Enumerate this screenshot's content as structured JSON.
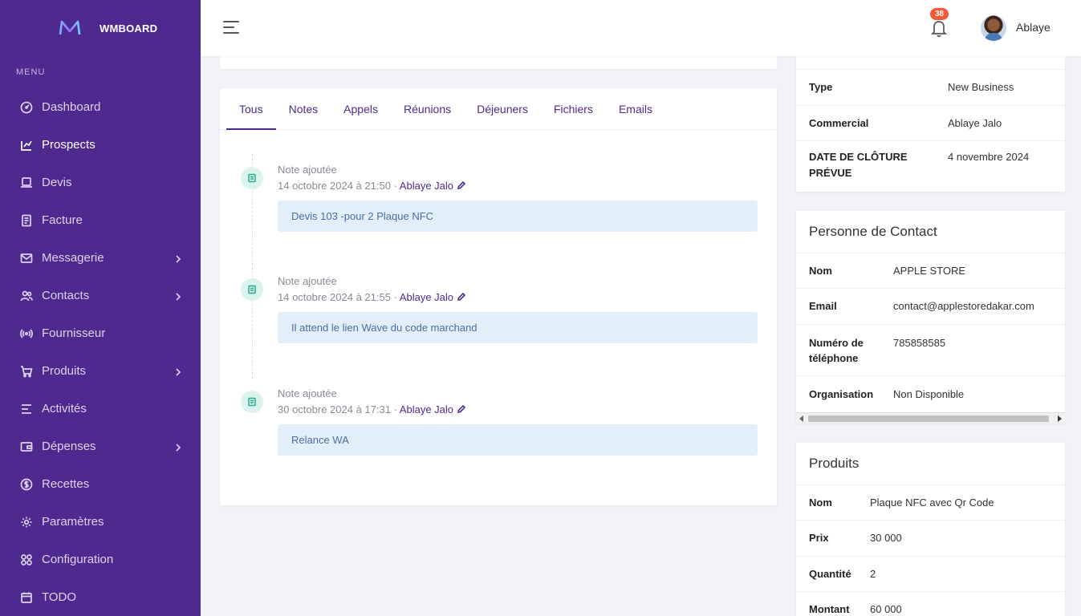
{
  "brand": {
    "name": "WMBOARD",
    "accent": "#4e2a8e"
  },
  "sidebar": {
    "menu_title": "MENU",
    "items": [
      {
        "label": "Dashboard",
        "icon": "gauge-icon",
        "chevron": false
      },
      {
        "label": "Prospects",
        "icon": "chart-icon",
        "chevron": false,
        "active": true
      },
      {
        "label": "Devis",
        "icon": "laptop-icon",
        "chevron": false
      },
      {
        "label": "Facture",
        "icon": "invoice-icon",
        "chevron": false
      },
      {
        "label": "Messagerie",
        "icon": "mail-icon",
        "chevron": true
      },
      {
        "label": "Contacts",
        "icon": "users-icon",
        "chevron": true
      },
      {
        "label": "Fournisseur",
        "icon": "broadcast-icon",
        "chevron": false
      },
      {
        "label": "Produits",
        "icon": "cart-icon",
        "chevron": true
      },
      {
        "label": "Activités",
        "icon": "list-icon",
        "chevron": false
      },
      {
        "label": "Dépenses",
        "icon": "wallet-icon",
        "chevron": true
      },
      {
        "label": "Recettes",
        "icon": "coin-icon",
        "chevron": false
      },
      {
        "label": "Paramètres",
        "icon": "gear-icon",
        "chevron": false
      },
      {
        "label": "Configuration",
        "icon": "grid-icon",
        "chevron": false
      },
      {
        "label": "TODO",
        "icon": "calendar-icon",
        "chevron": false
      }
    ]
  },
  "header": {
    "notification_count": "38",
    "user_name": "Ablaye"
  },
  "activity": {
    "tabs": [
      "Tous",
      "Notes",
      "Appels",
      "Réunions",
      "Déjeuners",
      "Fichiers",
      "Emails"
    ],
    "active_tab": "Tous",
    "entries": [
      {
        "title": "Note ajoutée",
        "date": "14 octobre 2024 à 21:50",
        "separator": " · ",
        "author": "Ablaye Jalo",
        "note": "Devis 103 -pour 2 Plaque NFC"
      },
      {
        "title": "Note ajoutée",
        "date": "14 octobre 2024 à 21:55",
        "separator": " · ",
        "author": "Ablaye Jalo",
        "note": "Il attend le lien Wave du code marchand"
      },
      {
        "title": "Note ajoutée",
        "date": "30 octobre 2024 à 17:31",
        "separator": " · ",
        "author": "Ablaye Jalo",
        "note": "Relance WA"
      }
    ]
  },
  "deal": {
    "rows": [
      {
        "key": "Type",
        "value": "New Business"
      },
      {
        "key": "Commercial",
        "value": "Ablaye Jalo"
      },
      {
        "key": "DATE DE CLÔTURE PRÉVUE",
        "value": "4 novembre 2024"
      }
    ]
  },
  "contact": {
    "title": "Personne de Contact",
    "rows": [
      {
        "key": "Nom",
        "value": "APPLE STORE"
      },
      {
        "key": "Email",
        "value": "contact@applestoredakar.com"
      },
      {
        "key": "Numéro de téléphone",
        "value": "785858585"
      },
      {
        "key": "Organisation",
        "value": "Non Disponible"
      }
    ]
  },
  "products": {
    "title": "Produits",
    "rows": [
      {
        "key": "Nom",
        "value": "Plaque NFC avec Qr Code"
      },
      {
        "key": "Prix",
        "value": "30 000"
      },
      {
        "key": "Quantité",
        "value": "2"
      },
      {
        "key": "Montant",
        "value": "60 000"
      }
    ]
  }
}
